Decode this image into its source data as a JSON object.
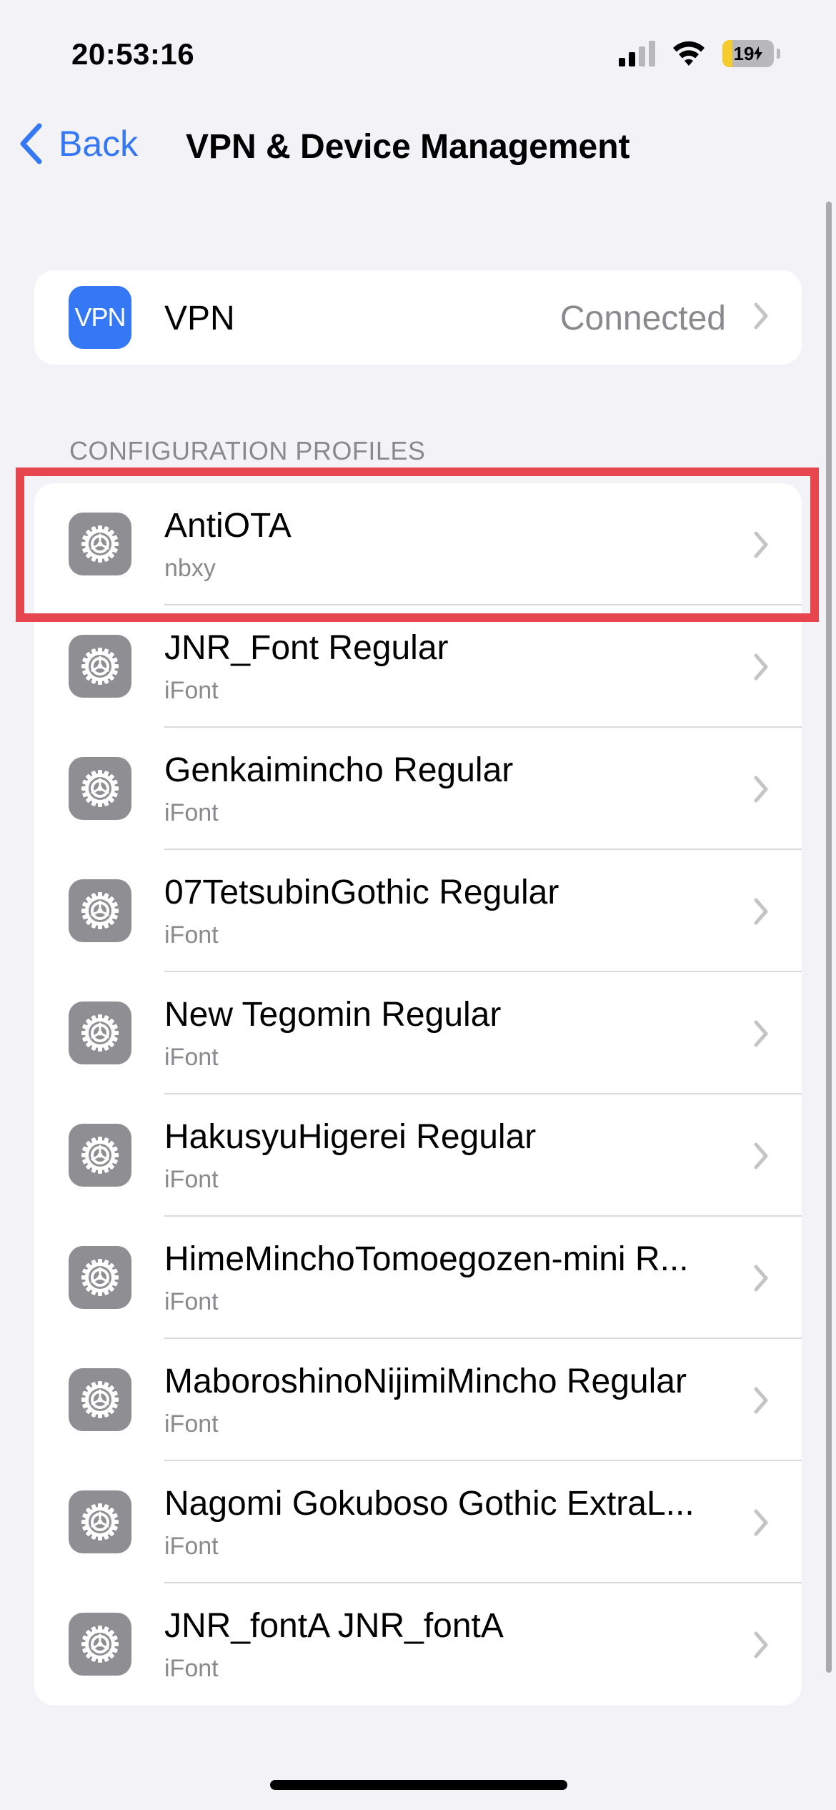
{
  "status_bar": {
    "time": "20:53:16",
    "battery_level": "19",
    "battery_fraction": 0.19,
    "signal_bars": 2,
    "signal_bars_total": 4,
    "icons": [
      "cellular-signal-icon",
      "wifi-icon",
      "battery-charging-icon"
    ]
  },
  "nav": {
    "back_label": "Back",
    "title": "VPN & Device Management"
  },
  "vpn": {
    "icon_text": "VPN",
    "label": "VPN",
    "status": "Connected",
    "icon_color": "#3478f6"
  },
  "profiles": {
    "section_title": "CONFIGURATION PROFILES",
    "items": [
      {
        "title": "AntiOTA",
        "subtitle": "nbxy"
      },
      {
        "title": "JNR_Font Regular",
        "subtitle": "iFont"
      },
      {
        "title": "Genkaimincho Regular",
        "subtitle": "iFont"
      },
      {
        "title": "07TetsubinGothic Regular",
        "subtitle": "iFont"
      },
      {
        "title": "New Tegomin Regular",
        "subtitle": "iFont"
      },
      {
        "title": "HakusyuHigerei Regular",
        "subtitle": "iFont"
      },
      {
        "title": "HimeMinchoTomoegozen-mini R...",
        "subtitle": "iFont"
      },
      {
        "title": "MaboroshinoNijimiMincho Regular",
        "subtitle": "iFont"
      },
      {
        "title": "Nagomi Gokuboso Gothic ExtraL...",
        "subtitle": "iFont"
      },
      {
        "title": "JNR_fontA JNR_fontA",
        "subtitle": "iFont"
      }
    ]
  },
  "colors": {
    "accent": "#3478f6",
    "highlight": "#e8464f",
    "background": "#f2f2f7",
    "profile_icon": "#8e8e93"
  }
}
